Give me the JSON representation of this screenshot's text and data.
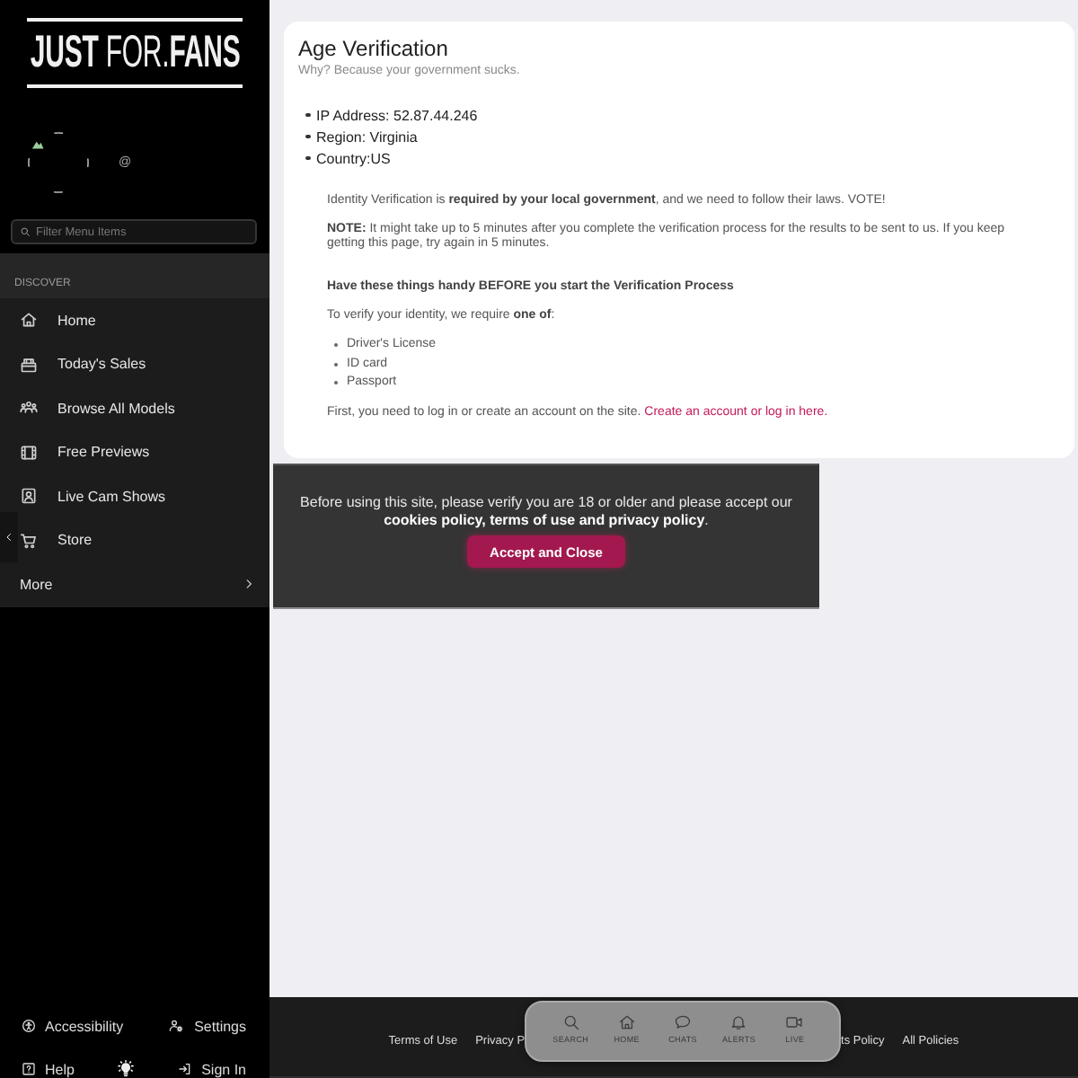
{
  "sidebar": {
    "logo": "**JUST** FOR.**FANS**",
    "user": {
      "handle": "@"
    },
    "filter": {
      "placeholder": "Filter Menu Items"
    },
    "section": "DISCOVER",
    "items": [
      {
        "label": "Home",
        "kind": "link"
      },
      {
        "label": "Today's Sales",
        "kind": "link"
      },
      {
        "label": "Browse All Models",
        "kind": "link"
      },
      {
        "label": "Free Previews",
        "kind": "link"
      },
      {
        "label": "Live Cam Shows",
        "kind": "link"
      },
      {
        "label": "Store",
        "kind": "link"
      },
      {
        "label": "More",
        "kind": "submenu"
      }
    ],
    "bottom": [
      [
        {
          "label": "Accessibility",
          "kind": "link"
        },
        {
          "label": "Settings",
          "kind": "link"
        }
      ],
      [
        {
          "label": "Help",
          "kind": "link"
        },
        {
          "kind": "theme-toggle"
        },
        {
          "label": "Sign In",
          "kind": "link"
        }
      ]
    ]
  },
  "verification": {
    "title": "Age Verification",
    "subtitle": "Why? Because your government sucks.",
    "details": [
      "IP Address: 52.87.44.246",
      "Region: Virginia",
      "Country:US"
    ],
    "intro": "Identity Verification is **required by your local government**, and we need to follow their laws. VOTE!",
    "note": "**NOTE:** It might take up to 5 minutes after you complete the verification process for the results to be sent to us. If you keep getting this page, try again in 5 minutes.",
    "checklist_heading": "Have these things handy BEFORE you start the Verification Process",
    "requirement": "To verify your identity, we require **one of**:",
    "documents": [
      "Driver's License",
      "ID card",
      "Passport"
    ],
    "login_text": "First, you need to log in or create an account on the site.",
    "login_link": "Create an account or log in here."
  },
  "cookie_banner": {
    "text": "Before using this site, please verify you are 18 or older and please accept our **cookies policy, terms of use and privacy policy**.",
    "button": "Accept and Close"
  },
  "footer": {
    "links": [
      "Terms of Use",
      "Privacy P",
      "ts Policy",
      "All Policies"
    ]
  },
  "bottom_nav": [
    {
      "label": "SEARCH"
    },
    {
      "label": "HOME"
    },
    {
      "label": "CHATS"
    },
    {
      "label": "ALERTS"
    },
    {
      "label": "LIVE"
    }
  ]
}
